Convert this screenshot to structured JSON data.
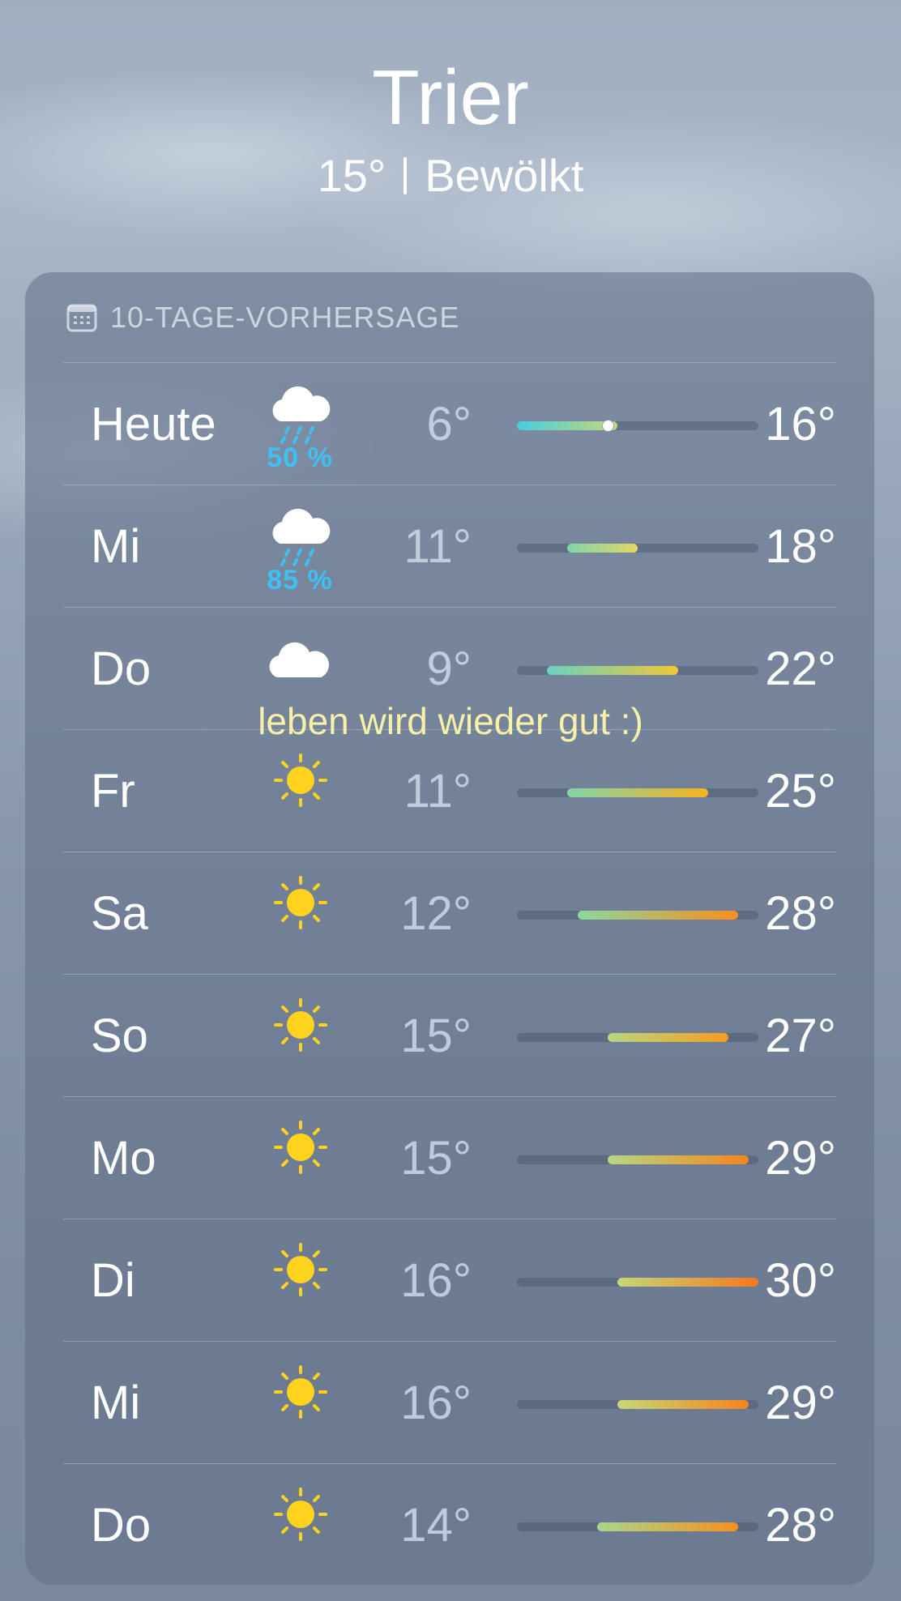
{
  "location": {
    "city": "Trier",
    "current_temp": "15°",
    "condition": "Bewölkt"
  },
  "forecast": {
    "title": "10-TAGE-VORHERSAGE",
    "icon": "calendar-icon",
    "range_min": 6,
    "range_max": 30,
    "days": [
      {
        "day": "Heute",
        "icon": "cloud-rain-icon",
        "precip": "50 %",
        "low": "6°",
        "high": "16°",
        "low_v": 6,
        "high_v": 16,
        "current_v": 15
      },
      {
        "day": "Mi",
        "icon": "cloud-rain-icon",
        "precip": "85 %",
        "low": "11°",
        "high": "18°",
        "low_v": 11,
        "high_v": 18
      },
      {
        "day": "Do",
        "icon": "cloud-icon",
        "low": "9°",
        "high": "22°",
        "low_v": 9,
        "high_v": 22
      },
      {
        "day": "Fr",
        "icon": "sun-icon",
        "low": "11°",
        "high": "25°",
        "low_v": 11,
        "high_v": 25
      },
      {
        "day": "Sa",
        "icon": "sun-icon",
        "low": "12°",
        "high": "28°",
        "low_v": 12,
        "high_v": 28
      },
      {
        "day": "So",
        "icon": "sun-icon",
        "low": "15°",
        "high": "27°",
        "low_v": 15,
        "high_v": 27
      },
      {
        "day": "Mo",
        "icon": "sun-icon",
        "low": "15°",
        "high": "29°",
        "low_v": 15,
        "high_v": 29
      },
      {
        "day": "Di",
        "icon": "sun-icon",
        "low": "16°",
        "high": "30°",
        "low_v": 16,
        "high_v": 30
      },
      {
        "day": "Mi",
        "icon": "sun-icon",
        "low": "16°",
        "high": "29°",
        "low_v": 16,
        "high_v": 29
      },
      {
        "day": "Do",
        "icon": "sun-icon",
        "low": "14°",
        "high": "28°",
        "low_v": 14,
        "high_v": 28
      }
    ]
  },
  "overlay_text": "leben wird wieder gut :)",
  "colors": {
    "precip": "#3fc0f5",
    "overlay": "#f6f0a8",
    "sun": "#ffd21e",
    "cold": "#4fd0e0",
    "hot": "#f58a1e"
  }
}
